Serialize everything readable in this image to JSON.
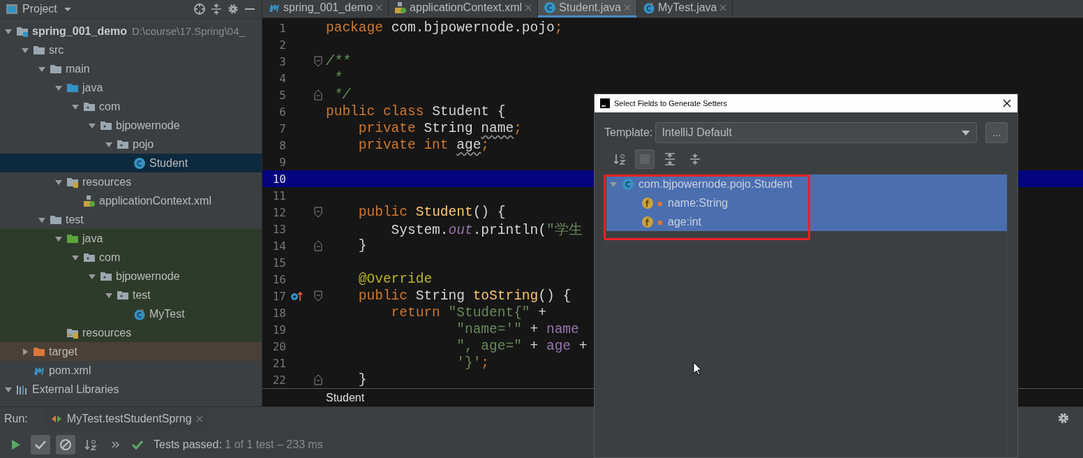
{
  "project_panel": {
    "title": "Project",
    "tree": [
      {
        "label": "spring_001_demo",
        "path": "D:\\course\\17.Spring\\04_",
        "kind": "module",
        "expanded": true,
        "selected": false,
        "children": [
          {
            "label": "src",
            "kind": "folder",
            "expanded": true,
            "selected": false,
            "children": [
              {
                "label": "main",
                "kind": "folder",
                "expanded": true,
                "selected": false,
                "children": [
                  {
                    "label": "java",
                    "kind": "source-folder",
                    "expanded": true,
                    "selected": false,
                    "children": [
                      {
                        "label": "com",
                        "kind": "package",
                        "expanded": true,
                        "selected": false,
                        "children": [
                          {
                            "label": "bjpowernode",
                            "kind": "package",
                            "expanded": true,
                            "selected": false,
                            "children": [
                              {
                                "label": "pojo",
                                "kind": "package",
                                "expanded": true,
                                "selected": false,
                                "children": [
                                  {
                                    "label": "Student",
                                    "kind": "class",
                                    "selected": true
                                  }
                                ]
                              }
                            ]
                          }
                        ]
                      }
                    ]
                  },
                  {
                    "label": "resources",
                    "kind": "resources",
                    "expanded": true,
                    "selected": false,
                    "children": [
                      {
                        "label": "applicationContext.xml",
                        "kind": "xml",
                        "selected": false
                      }
                    ]
                  }
                ]
              },
              {
                "label": "test",
                "kind": "folder",
                "expanded": true,
                "selected": false,
                "children": [
                  {
                    "label": "java",
                    "kind": "test-source-folder",
                    "expanded": true,
                    "selected": false,
                    "children": [
                      {
                        "label": "com",
                        "kind": "test-package",
                        "expanded": true,
                        "selected": false,
                        "children": [
                          {
                            "label": "bjpowernode",
                            "kind": "test-package",
                            "expanded": true,
                            "selected": false,
                            "children": [
                              {
                                "label": "test",
                                "kind": "test-package",
                                "expanded": true,
                                "selected": false,
                                "children": [
                                  {
                                    "label": "MyTest",
                                    "kind": "test-class",
                                    "selected": false
                                  }
                                ]
                              }
                            ]
                          }
                        ]
                      }
                    ]
                  },
                  {
                    "label": "resources",
                    "kind": "test-resources",
                    "selected": false
                  }
                ]
              }
            ]
          },
          {
            "label": "target",
            "kind": "excluded-folder",
            "expanded": false,
            "selected": false
          },
          {
            "label": "pom.xml",
            "kind": "maven",
            "selected": false
          }
        ]
      },
      {
        "label": "External Libraries",
        "kind": "libraries",
        "expanded": true,
        "selected": false
      }
    ]
  },
  "editor": {
    "tabs": [
      {
        "label": "spring_001_demo",
        "kind": "maven",
        "selected": false
      },
      {
        "label": "applicationContext.xml",
        "kind": "xml",
        "selected": false
      },
      {
        "label": "Student.java",
        "kind": "class",
        "selected": true
      },
      {
        "label": "MyTest.java",
        "kind": "test-class",
        "selected": false
      }
    ],
    "lines": [
      {
        "number": "1",
        "current": false,
        "fold_start": false,
        "fold_end": false,
        "override": false,
        "tokens": [
          {
            "text": "package ",
            "kind": "keyword"
          },
          {
            "text": "com.bjpowernode.pojo",
            "kind": "plain"
          },
          {
            "text": ";",
            "kind": "keyword"
          }
        ]
      },
      {
        "number": "2",
        "current": false,
        "fold_start": false,
        "fold_end": false,
        "override": false
      },
      {
        "number": "3",
        "current": false,
        "fold_start": true,
        "fold_end": false,
        "override": false,
        "tokens": [
          {
            "text": "/**",
            "kind": "comment"
          }
        ]
      },
      {
        "number": "4",
        "current": false,
        "fold_start": false,
        "fold_end": false,
        "override": false,
        "tokens": [
          {
            "text": " *",
            "kind": "comment"
          }
        ]
      },
      {
        "number": "5",
        "current": false,
        "fold_start": false,
        "fold_end": true,
        "override": false,
        "tokens": [
          {
            "text": " */",
            "kind": "comment"
          }
        ]
      },
      {
        "number": "6",
        "current": false,
        "fold_start": false,
        "fold_end": false,
        "override": false,
        "tokens": [
          {
            "text": "public class ",
            "kind": "keyword"
          },
          {
            "text": "Student {",
            "kind": "plain"
          }
        ]
      },
      {
        "number": "7",
        "current": false,
        "fold_start": false,
        "fold_end": false,
        "override": false,
        "tokens": [
          {
            "text": "    private ",
            "kind": "keyword"
          },
          {
            "text": "String ",
            "kind": "plain"
          },
          {
            "text": "name",
            "kind": "unused"
          },
          {
            "text": ";",
            "kind": "keyword"
          }
        ]
      },
      {
        "number": "8",
        "current": false,
        "fold_start": false,
        "fold_end": false,
        "override": false,
        "tokens": [
          {
            "text": "    private int ",
            "kind": "keyword"
          },
          {
            "text": "age",
            "kind": "unused"
          },
          {
            "text": ";",
            "kind": "keyword"
          }
        ]
      },
      {
        "number": "9",
        "current": false,
        "fold_start": false,
        "fold_end": false,
        "override": false
      },
      {
        "number": "10",
        "current": true,
        "fold_start": false,
        "fold_end": false,
        "override": false
      },
      {
        "number": "11",
        "current": false,
        "fold_start": false,
        "fold_end": false,
        "override": false
      },
      {
        "number": "12",
        "current": false,
        "fold_start": true,
        "fold_end": false,
        "override": false,
        "tokens": [
          {
            "text": "    public ",
            "kind": "keyword"
          },
          {
            "text": "Student",
            "kind": "method"
          },
          {
            "text": "() {",
            "kind": "plain"
          }
        ]
      },
      {
        "number": "13",
        "current": false,
        "fold_start": false,
        "fold_end": false,
        "override": false,
        "tokens": [
          {
            "text": "        System.",
            "kind": "plain"
          },
          {
            "text": "out",
            "kind": "static"
          },
          {
            "text": ".println(",
            "kind": "plain"
          },
          {
            "text": "\"学生",
            "kind": "string"
          }
        ]
      },
      {
        "number": "14",
        "current": false,
        "fold_start": false,
        "fold_end": true,
        "override": false,
        "tokens": [
          {
            "text": "    }",
            "kind": "plain"
          }
        ]
      },
      {
        "number": "15",
        "current": false,
        "fold_start": false,
        "fold_end": false,
        "override": false
      },
      {
        "number": "16",
        "current": false,
        "fold_start": false,
        "fold_end": false,
        "override": false,
        "tokens": [
          {
            "text": "    @Override",
            "kind": "annotation"
          }
        ]
      },
      {
        "number": "17",
        "current": false,
        "fold_start": true,
        "fold_end": false,
        "override": true,
        "tokens": [
          {
            "text": "    public ",
            "kind": "keyword"
          },
          {
            "text": "String ",
            "kind": "plain"
          },
          {
            "text": "toString",
            "kind": "method"
          },
          {
            "text": "() {",
            "kind": "plain"
          }
        ]
      },
      {
        "number": "18",
        "current": false,
        "fold_start": false,
        "fold_end": false,
        "override": false,
        "tokens": [
          {
            "text": "        return ",
            "kind": "keyword"
          },
          {
            "text": "\"Student{\"",
            "kind": "string"
          },
          {
            "text": " +",
            "kind": "plain"
          }
        ]
      },
      {
        "number": "19",
        "current": false,
        "fold_start": false,
        "fold_end": false,
        "override": false,
        "tokens": [
          {
            "text": "                \"name='\"",
            "kind": "string"
          },
          {
            "text": " + ",
            "kind": "plain"
          },
          {
            "text": "name",
            "kind": "field"
          }
        ]
      },
      {
        "number": "20",
        "current": false,
        "fold_start": false,
        "fold_end": false,
        "override": false,
        "tokens": [
          {
            "text": "                \", age=\"",
            "kind": "string"
          },
          {
            "text": " + ",
            "kind": "plain"
          },
          {
            "text": "age",
            "kind": "field"
          },
          {
            "text": " +",
            "kind": "plain"
          }
        ]
      },
      {
        "number": "21",
        "current": false,
        "fold_start": false,
        "fold_end": false,
        "override": false,
        "tokens": [
          {
            "text": "                '}'",
            "kind": "string"
          },
          {
            "text": ";",
            "kind": "keyword"
          }
        ]
      },
      {
        "number": "22",
        "current": false,
        "fold_start": false,
        "fold_end": true,
        "override": false,
        "tokens": [
          {
            "text": "    }",
            "kind": "plain"
          }
        ]
      }
    ],
    "breadcrumb": "Student"
  },
  "run_panel": {
    "label": "Run:",
    "tab": "MyTest.testStudentSprng",
    "toolbar": [
      {
        "kind": "rerun",
        "selected": false
      },
      {
        "kind": "passed",
        "selected": true
      },
      {
        "kind": "ignored",
        "selected": true
      },
      {
        "kind": "sort",
        "selected": false
      },
      {
        "kind": "more",
        "selected": false
      }
    ],
    "status": "Tests passed:",
    "status_detail": "1 of 1 test – 233 ms"
  },
  "dialog": {
    "title": "Select Fields to Generate Setters",
    "template_label": "Template:",
    "template_value": "IntelliJ Default",
    "more_button": "...",
    "toolbar": [
      {
        "kind": "sort",
        "selected": false
      },
      {
        "kind": "toggle",
        "selected": true
      },
      {
        "kind": "expand",
        "selected": false
      },
      {
        "kind": "collapse",
        "selected": false
      }
    ],
    "tree": [
      {
        "label": "com.bjpowernode.pojo.Student",
        "kind": "class",
        "expanded": true,
        "selected": true,
        "children": [
          {
            "label": "name:String",
            "kind": "field",
            "selected": true
          },
          {
            "label": "age:int",
            "kind": "field",
            "selected": true
          }
        ]
      }
    ]
  }
}
